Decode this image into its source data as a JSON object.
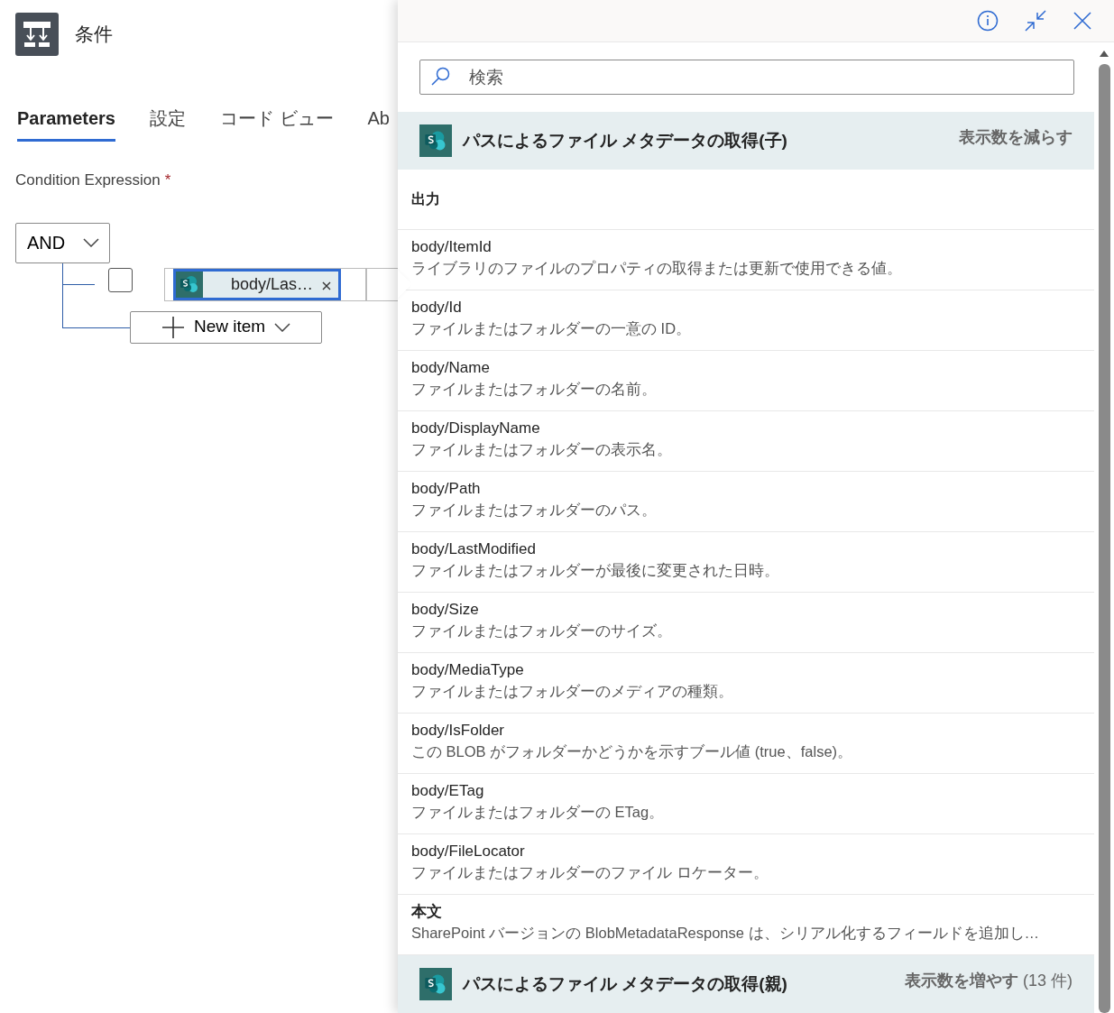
{
  "header": {
    "title": "条件"
  },
  "tabs": [
    {
      "label": "Parameters",
      "selected": true
    },
    {
      "label": "設定",
      "selected": false
    },
    {
      "label": "コード ビュー",
      "selected": false
    },
    {
      "label": "Ab",
      "selected": false
    }
  ],
  "condition": {
    "label": "Condition Expression",
    "required_marker": "*",
    "operator": "AND",
    "row": {
      "checked": false,
      "token": "body/Las…"
    },
    "new_item": "New item"
  },
  "panel": {
    "search": {
      "placeholder": "検索"
    },
    "sections": [
      {
        "title": "パスによるファイル メタデータの取得(子)",
        "toggle": "表示数を減らす",
        "subheading": "出力",
        "items": [
          {
            "name": "body/ItemId",
            "description": "ライブラリのファイルのプロパティの取得または更新で使用できる値。"
          },
          {
            "name": "body/Id",
            "description": "ファイルまたはフォルダーの一意の ID。"
          },
          {
            "name": "body/Name",
            "description": "ファイルまたはフォルダーの名前。"
          },
          {
            "name": "body/DisplayName",
            "description": "ファイルまたはフォルダーの表示名。"
          },
          {
            "name": "body/Path",
            "description": "ファイルまたはフォルダーのパス。"
          },
          {
            "name": "body/LastModified",
            "description": "ファイルまたはフォルダーが最後に変更された日時。"
          },
          {
            "name": "body/Size",
            "description": "ファイルまたはフォルダーのサイズ。"
          },
          {
            "name": "body/MediaType",
            "description": "ファイルまたはフォルダーのメディアの種類。"
          },
          {
            "name": "body/IsFolder",
            "description": "この BLOB がフォルダーかどうかを示すブール値 (true、false)。"
          },
          {
            "name": "body/ETag",
            "description": "ファイルまたはフォルダーの ETag。"
          },
          {
            "name": "body/FileLocator",
            "description": "ファイルまたはフォルダーのファイル ロケーター。"
          },
          {
            "name": "本文",
            "description": "SharePoint バージョンの BlobMetadataResponse は、シリアル化するフィールドを追加し…"
          }
        ]
      },
      {
        "title": "パスによるファイル メタデータの取得(親)",
        "toggle": "表示数を増やす",
        "count": "(13 件)"
      }
    ]
  }
}
